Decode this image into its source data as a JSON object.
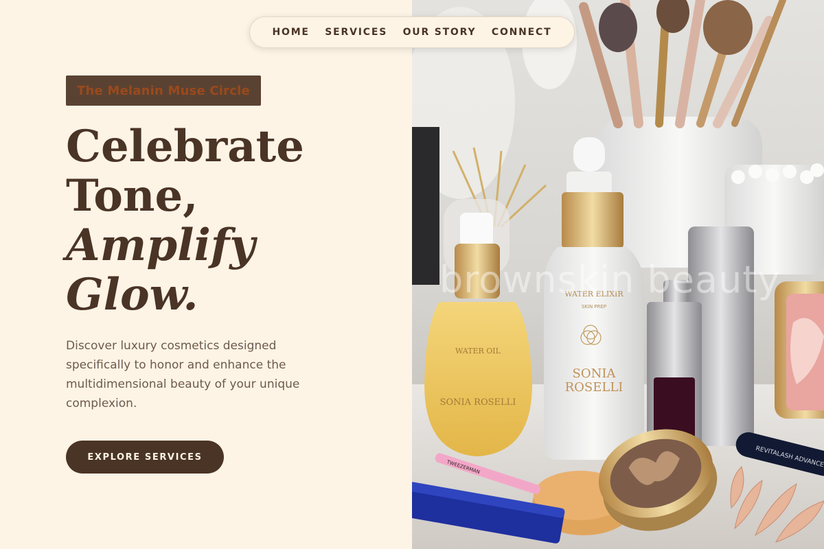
{
  "nav": {
    "items": [
      "HOME",
      "SERVICES",
      "OUR STORY",
      "CONNECT"
    ]
  },
  "hero": {
    "badge": "The Melanin Muse Circle",
    "headline": {
      "line1": "Celebrate",
      "line2": "Tone,",
      "line3": "Amplify",
      "line4": "Glow."
    },
    "description": "Discover luxury cosmetics designed specifically to honor and enhance the multidimensional beauty of your unique complexion.",
    "cta_label": "EXPLORE SERVICES"
  },
  "image": {
    "watermark": "brownskin beauty",
    "bottle_left_line1": "WATER OIL",
    "bottle_left_line2": "SONIA ROSELLI",
    "bottle_center_line1": "WATER ELIXIR",
    "bottle_center_line2": "SKIN PREP",
    "bottle_center_line3": "SONIA",
    "bottle_center_line4": "ROSELLI",
    "tube_label": "REVITALASH ADVANCED",
    "tweezer_label": "TWEEZERMAN"
  },
  "colors": {
    "background": "#fdf4e6",
    "primary_brown": "#4a3426",
    "badge_bg": "#5a4232",
    "badge_text": "#9a4a1c",
    "body_text": "#6e5a4a"
  }
}
